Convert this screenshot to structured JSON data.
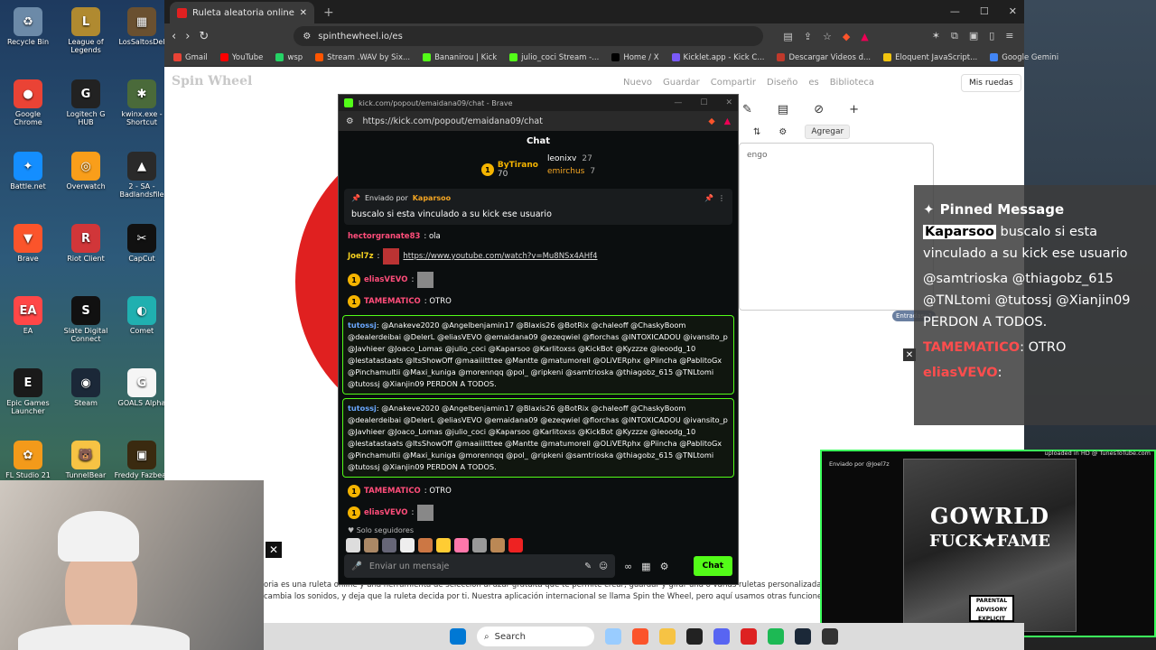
{
  "desktop": {
    "icons": [
      {
        "label": "Recycle Bin",
        "color": "#6c8aa8",
        "glyph": "♻"
      },
      {
        "label": "League of Legends",
        "color": "#b08a30",
        "glyph": "L"
      },
      {
        "label": "LosSaltosDel",
        "color": "#6a5030",
        "glyph": "▦"
      },
      {
        "label": "Google Chrome",
        "color": "#ea4335",
        "glyph": "●"
      },
      {
        "label": "Logitech G HUB",
        "color": "#222222",
        "glyph": "G"
      },
      {
        "label": "kwinx.exe - Shortcut",
        "color": "#4a6a3a",
        "glyph": "✱"
      },
      {
        "label": "Battle.net",
        "color": "#148eff",
        "glyph": "✦"
      },
      {
        "label": "Overwatch",
        "color": "#f99e1a",
        "glyph": "◎"
      },
      {
        "label": "2 - SA - Badlandsfile",
        "color": "#2a2a2a",
        "glyph": "▲"
      },
      {
        "label": "Brave",
        "color": "#fb542b",
        "glyph": "▼"
      },
      {
        "label": "Riot Client",
        "color": "#d13639",
        "glyph": "R"
      },
      {
        "label": "CapCut",
        "color": "#111111",
        "glyph": "✂"
      },
      {
        "label": "EA",
        "color": "#ff4747",
        "glyph": "EA"
      },
      {
        "label": "Slate Digital Connect",
        "color": "#111111",
        "glyph": "S"
      },
      {
        "label": "Comet",
        "color": "#20b0b0",
        "glyph": "◐"
      },
      {
        "label": "Epic Games Launcher",
        "color": "#1a1a1a",
        "glyph": "E"
      },
      {
        "label": "Steam",
        "color": "#1b2838",
        "glyph": "◉"
      },
      {
        "label": "GOALS Alpha",
        "color": "#f5f5f5",
        "glyph": "G"
      },
      {
        "label": "FL Studio 21",
        "color": "#f39a1a",
        "glyph": "✿"
      },
      {
        "label": "TunnelBear",
        "color": "#f6c344",
        "glyph": "🐻"
      },
      {
        "label": "Freddy Fazbear",
        "color": "#3a2a10",
        "glyph": "▣"
      }
    ]
  },
  "browser": {
    "tab_title": "Ruleta aleatoria online – ruleta d",
    "new_tab": "+",
    "url": "spinthewheel.io/es",
    "window_controls": [
      "—",
      "☐",
      "✕"
    ],
    "bookmarks": [
      {
        "label": "Gmail",
        "color": "#ea4335"
      },
      {
        "label": "YouTube",
        "color": "#ff0000"
      },
      {
        "label": "wsp",
        "color": "#25d366"
      },
      {
        "label": "Stream .WAV by Six...",
        "color": "#ff5500"
      },
      {
        "label": "Bananirou | Kick",
        "color": "#53fc18"
      },
      {
        "label": "julio_coci Stream -...",
        "color": "#53fc18"
      },
      {
        "label": "Home / X",
        "color": "#000000"
      },
      {
        "label": "Kicklet.app - Kick C...",
        "color": "#7a5af8"
      },
      {
        "label": "Descargar Videos d...",
        "color": "#c0392b"
      },
      {
        "label": "Eloquent JavaScript...",
        "color": "#f1c40f"
      },
      {
        "label": "Google Gemini",
        "color": "#4285f4"
      }
    ]
  },
  "page": {
    "logo": "Spin Wheel",
    "nav": [
      "Nuevo",
      "Guardar",
      "Compartir",
      "Diseño",
      "es",
      "Biblioteca"
    ],
    "mis_ruedas": "Mis ruedas",
    "agregar": "Agregar",
    "list_text": "engo",
    "entradas": "Entradas: 1",
    "bottom_text": "oria es una ruleta online y una herramienta de selección al azar gratuita que te permite crear, guardar y girar una o varias ruletas personalizadas en línea. Ingresa nombres, aplica temas y cambia los sonidos, y deja que la ruleta decida por ti. Nuestra aplicación internacional se llama Spin the Wheel, pero aquí usamos otras funciones."
  },
  "popout": {
    "window_title": "kick.com/popout/emaidana09/chat - Brave",
    "url": "https://kick.com/popout/emaidana09/chat",
    "header": "Chat",
    "leaders": {
      "first": {
        "name": "ByTirano",
        "count": "70"
      },
      "second": {
        "name": "leonixv",
        "count": "27"
      },
      "third": {
        "name": "emirchus",
        "count": "7"
      }
    },
    "pinned": {
      "sent_by": "Enviado por",
      "user": "Kaparsoo",
      "message": "buscalo si esta vinculado a su kick ese usuario"
    },
    "messages": [
      {
        "user": "hectorgranate83",
        "text": ": ola"
      },
      {
        "user": "Joel7z",
        "text": ":",
        "link": "https://www.youtube.com/watch?v=Mu8NSx4AHf4"
      },
      {
        "user": "eliasVEVO",
        "text": ":"
      },
      {
        "user": "TAMEMATICO",
        "text": ": OTRO"
      }
    ],
    "mention1": {
      "user": "tutossj",
      "text": ": @Anakeve2020 @Angelbenjamin17 @Blaxis26 @BotRix @chaleoff @ChaskyBoom @dealerdeibai @DelerL @eliasVEVO @emaidana09 @ezeqwiel @florchas @INTOXICADOU @ivansito_p @Javhieer @Joaco_Lomas @julio_coci @Kaparsoo @Karlitoxss @KickBot @Kyzzze @leoodg_10 @lestatastaats @ItsShowOff @maaiiitttee @Mantte @matumorell @OLiVERphx @Piincha @PablitoGx @Pinchamultii @Maxi_kuniga @morennqq @pol_ @ripkeni @samtrioska @thiagobz_615 @TNLtomi @tutossj @Xianjin09 PERDON A TODOS."
    },
    "mention2": {
      "user": "tutossj",
      "text": ": @Anakeve2020 @Angelbenjamin17 @Blaxis26 @BotRix @chaleoff @ChaskyBoom @dealerdeibai @DelerL @eliasVEVO @emaidana09 @ezeqwiel @florchas @INTOXICADOU @ivansito_p @Javhieer @Joaco_Lomas @julio_coci @Kaparsoo @Karlitoxss @KickBot @Kyzzze @leoodg_10 @lestatastaats @ItsShowOff @maaiiitttee @Mantte @matumorell @OLiVERphx @Piincha @PablitoGx @Pinchamultii @Maxi_kuniga @morennqq @pol_ @ripkeni @samtrioska @thiagobz_615 @TNLtomi @tutossj @Xianjin09 PERDON A TODOS."
    },
    "after": [
      {
        "user": "TAMEMATICO",
        "text": ": OTRO"
      },
      {
        "user": "eliasVEVO",
        "text": ":"
      }
    ],
    "followers_only": "Solo seguidores",
    "input_placeholder": "Enviar un mensaje",
    "chat_button": "Chat"
  },
  "overlay": {
    "title": "Pinned Message",
    "user": "Kaparsoo",
    "message": "buscalo si esta vinculado a su kick ese usuario",
    "mentions": "@samtrioska  @thiagobz_615 @TNLtomi @tutossj @Xianjin09 PERDON A TODOS.",
    "tame": "TAMEMATICO",
    "tame_text": ": OTRO",
    "elias": "eliasVEVO",
    "elias_text": ":"
  },
  "video": {
    "tag": "uploaded in HD @ TunesToTube.com",
    "sent_by": "Enviado por @Joel7z",
    "album_line1": "GOWRLD",
    "album_line2": "FUCK★FAME",
    "advisory": "PARENTAL ADVISORY EXPLICIT CONTENT"
  },
  "taskbar": {
    "search": "Search"
  }
}
